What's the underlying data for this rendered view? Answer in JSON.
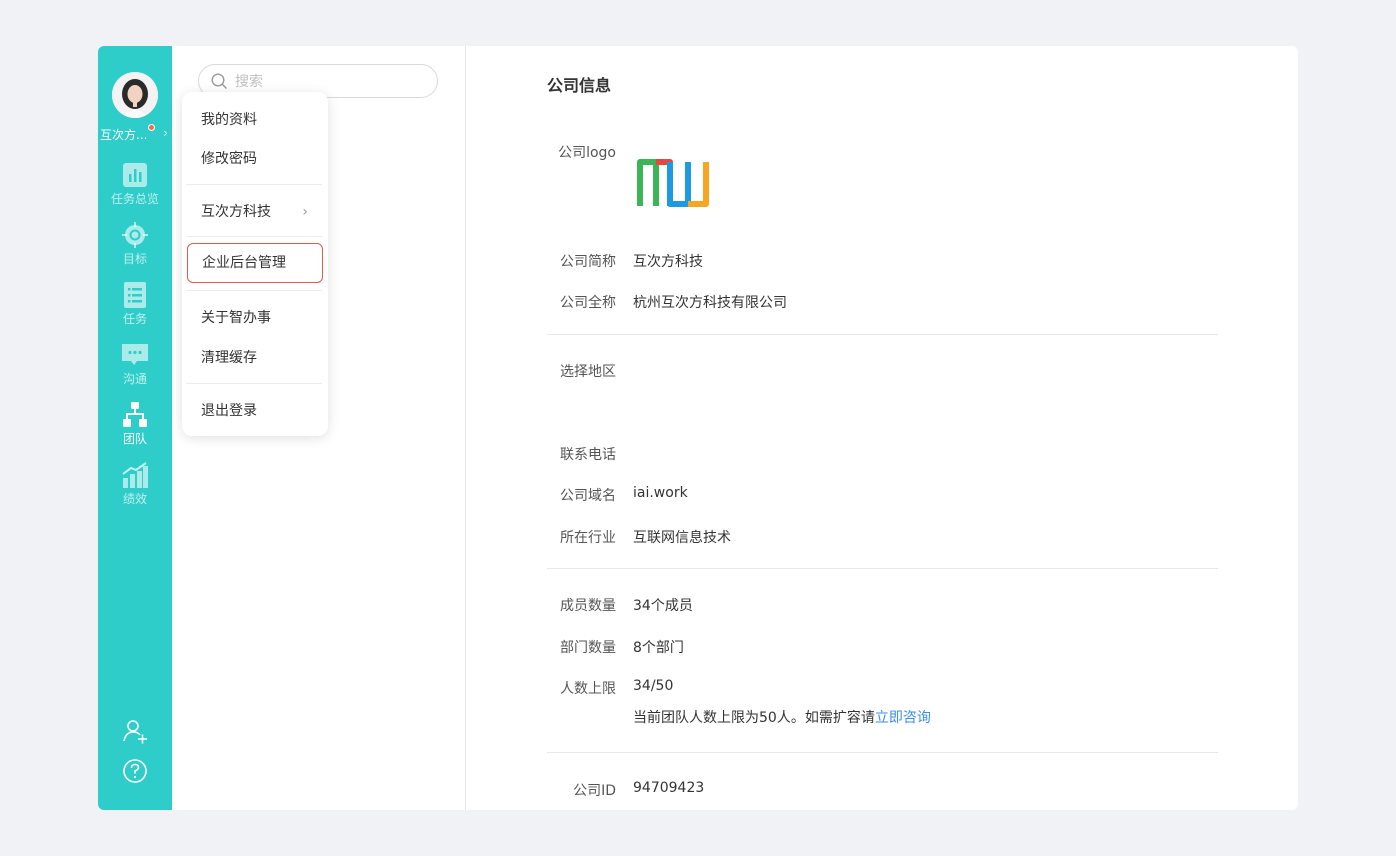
{
  "user": {
    "name": "互次方..."
  },
  "nav": [
    {
      "key": "overview",
      "label": "任务总览",
      "icon": "bar-chart-icon"
    },
    {
      "key": "goal",
      "label": "目标",
      "icon": "target-icon"
    },
    {
      "key": "task",
      "label": "任务",
      "icon": "list-icon"
    },
    {
      "key": "chat",
      "label": "沟通",
      "icon": "chat-icon"
    },
    {
      "key": "team",
      "label": "团队",
      "icon": "org-chart-icon",
      "active": true
    },
    {
      "key": "perf",
      "label": "绩效",
      "icon": "growth-chart-icon"
    }
  ],
  "rail_bottom": {
    "invite_icon": "add-user-icon",
    "help_icon": "help-icon"
  },
  "search": {
    "placeholder": "搜索",
    "value": ""
  },
  "menu": {
    "profile": "我的资料",
    "password": "修改密码",
    "company": "互次方科技",
    "admin": "企业后台管理",
    "about": "关于智办事",
    "clear_cache": "清理缓存",
    "logout": "退出登录"
  },
  "company_info": {
    "title": "公司信息",
    "logo_label": "公司logo",
    "short_name_label": "公司简称",
    "short_name": "互次方科技",
    "full_name_label": "公司全称",
    "full_name": "杭州互次方科技有限公司",
    "region_label": "选择地区",
    "phone_label": "联系电话",
    "domain_label": "公司域名",
    "domain": "iai.work",
    "industry_label": "所在行业",
    "industry": "互联网信息技术",
    "members_label": "成员数量",
    "members": "34个成员",
    "departments_label": "部门数量",
    "departments": "8个部门",
    "limit_label": "人数上限",
    "limit": "34/50",
    "limit_note": "当前团队人数上限为50人。如需扩容请",
    "limit_link": "立即咨询",
    "id_label": "公司ID",
    "id": "94709423"
  },
  "colors": {
    "rail": "#2ecdc9",
    "highlight_border": "#e05a4e",
    "link": "#3b8ee8",
    "logo_green": "#3bb556",
    "logo_red": "#e8473d",
    "logo_blue": "#1e9be0",
    "logo_orange": "#f5a623"
  }
}
